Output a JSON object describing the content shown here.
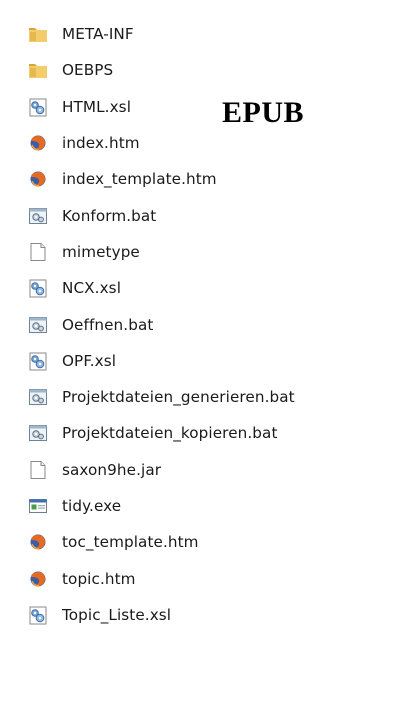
{
  "overlay_label": "EPUB",
  "files": [
    {
      "name": "META-INF",
      "icon": "folder-icon"
    },
    {
      "name": "OEBPS",
      "icon": "folder-icon"
    },
    {
      "name": "HTML.xsl",
      "icon": "xsl-file-icon"
    },
    {
      "name": "index.htm",
      "icon": "firefox-html-icon"
    },
    {
      "name": "index_template.htm",
      "icon": "firefox-html-icon"
    },
    {
      "name": "Konform.bat",
      "icon": "batch-file-icon"
    },
    {
      "name": "mimetype",
      "icon": "blank-file-icon"
    },
    {
      "name": "NCX.xsl",
      "icon": "xsl-file-icon"
    },
    {
      "name": "Oeffnen.bat",
      "icon": "batch-file-icon"
    },
    {
      "name": "OPF.xsl",
      "icon": "xsl-file-icon"
    },
    {
      "name": "Projektdateien_generieren.bat",
      "icon": "batch-file-icon"
    },
    {
      "name": "Projektdateien_kopieren.bat",
      "icon": "batch-file-icon"
    },
    {
      "name": "saxon9he.jar",
      "icon": "blank-file-icon"
    },
    {
      "name": "tidy.exe",
      "icon": "exe-file-icon"
    },
    {
      "name": "toc_template.htm",
      "icon": "firefox-html-icon"
    },
    {
      "name": "topic.htm",
      "icon": "firefox-html-icon"
    },
    {
      "name": "Topic_Liste.xsl",
      "icon": "xsl-file-icon"
    }
  ]
}
